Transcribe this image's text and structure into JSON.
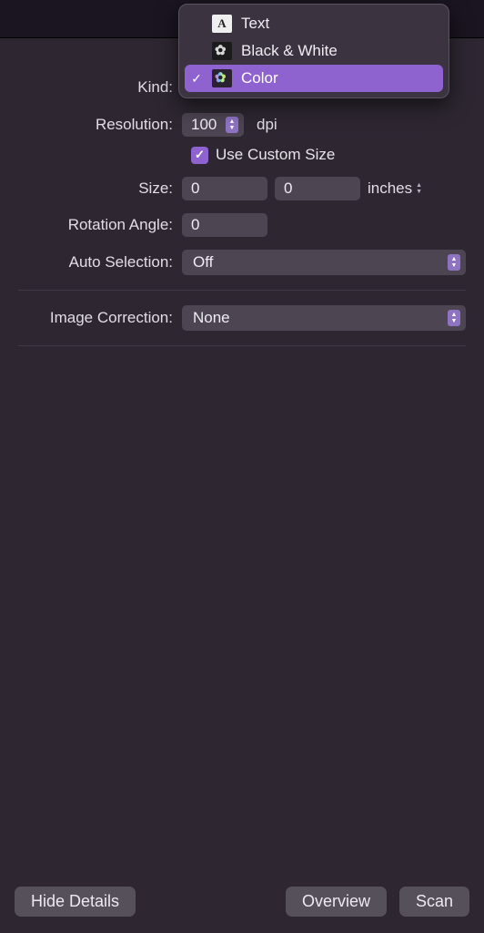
{
  "kind_dropdown": {
    "label": "Kind:",
    "options": [
      {
        "label": "Text"
      },
      {
        "label": "Black & White"
      },
      {
        "label": "Color"
      }
    ],
    "selected_index": 2
  },
  "resolution": {
    "label": "Resolution:",
    "value": "100",
    "unit": "dpi"
  },
  "custom_size": {
    "checked": true,
    "label": "Use Custom Size"
  },
  "size": {
    "label": "Size:",
    "width": "0",
    "height": "0",
    "unit": "inches"
  },
  "rotation": {
    "label": "Rotation Angle:",
    "value": "0"
  },
  "auto_selection": {
    "label": "Auto Selection:",
    "value": "Off"
  },
  "image_correction": {
    "label": "Image Correction:",
    "value": "None"
  },
  "footer": {
    "hide_details": "Hide Details",
    "overview": "Overview",
    "scan": "Scan"
  }
}
